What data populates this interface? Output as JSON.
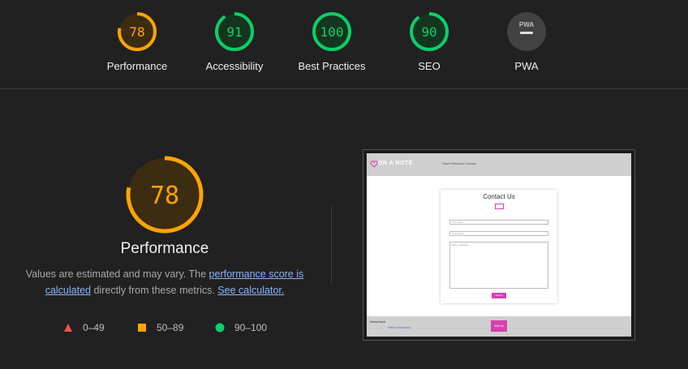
{
  "gauges": [
    {
      "label": "Performance",
      "score": "78",
      "value": 0.78,
      "color": "#ffa400"
    },
    {
      "label": "Accessibility",
      "score": "91",
      "value": 0.91,
      "color": "#0cce6b"
    },
    {
      "label": "Best Practices",
      "score": "100",
      "value": 1.0,
      "color": "#0cce6b"
    },
    {
      "label": "SEO",
      "score": "90",
      "value": 0.9,
      "color": "#0cce6b"
    },
    {
      "label": "PWA",
      "badge": "PWA",
      "color": "#9e9e9e"
    }
  ],
  "main": {
    "score": "78",
    "value": 0.78,
    "title": "Performance",
    "desc_1": "Values are estimated and may vary. The ",
    "link_1": "performance score is calculated",
    "desc_2": " directly from these metrics. ",
    "link_2": "See calculator."
  },
  "legend": [
    {
      "icon": "triangle",
      "range": "0–49",
      "color": "#ff4e42"
    },
    {
      "icon": "square",
      "range": "50–89",
      "color": "#ffa400"
    },
    {
      "icon": "circle",
      "range": "90–100",
      "color": "#0cce6b"
    }
  ],
  "screenshot": {
    "logo": "ON A NOTE",
    "nav_links": "Home  Reviews  Contact",
    "card_title": "Contact Us",
    "name_ph": "Your Name",
    "email_ph": "Your Email",
    "message_ph": "Enter message...",
    "submit": "Submit",
    "footer_title": "NewsHack",
    "footer_link": "GitHub Repository",
    "footer_button": "Visit Us"
  }
}
